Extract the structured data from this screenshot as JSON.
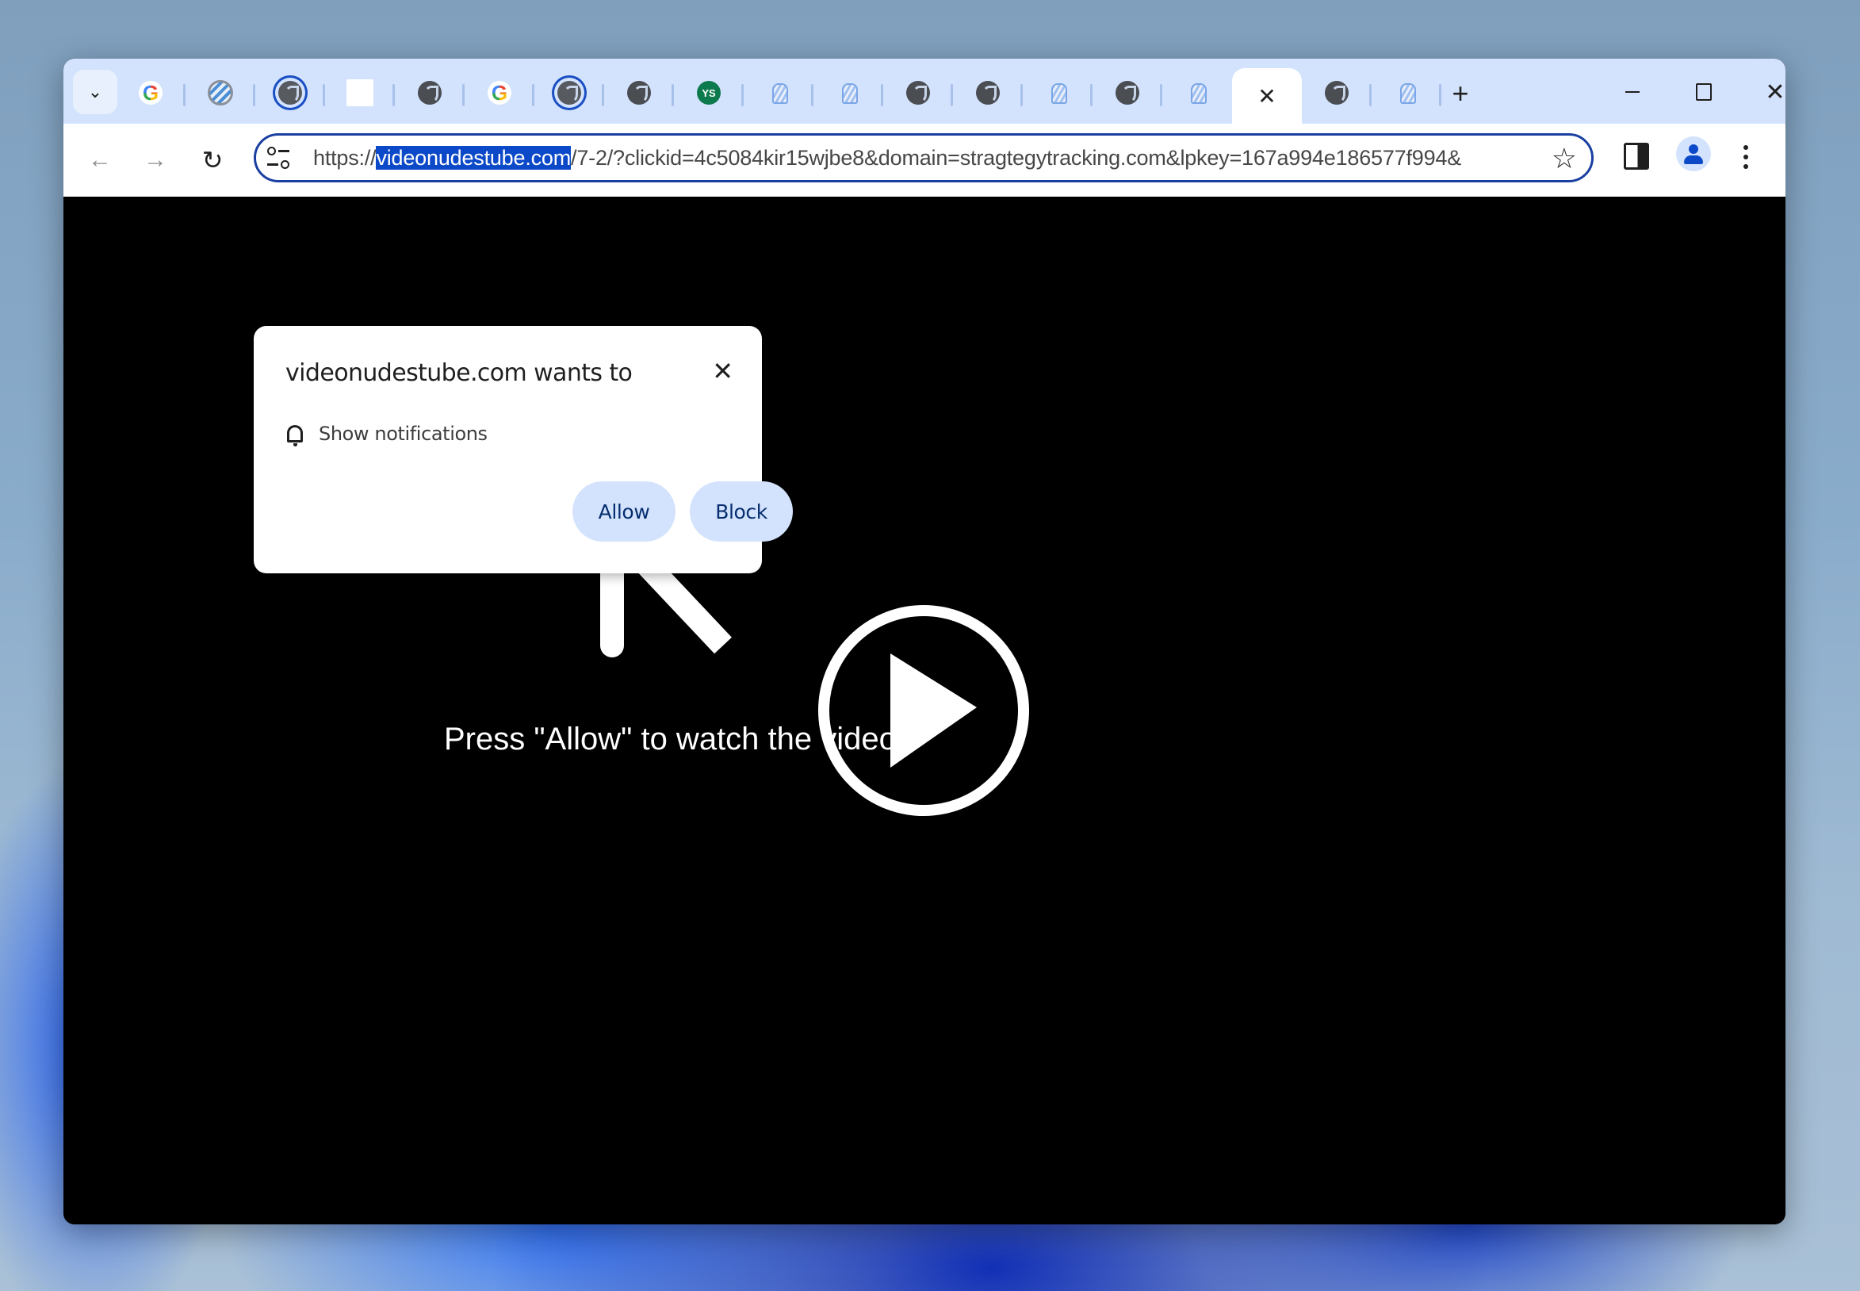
{
  "browser": {
    "tabs": [
      {
        "favicon": "google-icon",
        "active": false
      },
      {
        "favicon": "striped-circle-icon",
        "active": false
      },
      {
        "favicon": "loading-globe-icon",
        "active": false
      },
      {
        "favicon": "blank-page-icon",
        "active": false
      },
      {
        "favicon": "globe-icon",
        "active": false
      },
      {
        "favicon": "google-icon",
        "active": false
      },
      {
        "favicon": "loading-globe-icon",
        "active": false
      },
      {
        "favicon": "globe-icon",
        "active": false
      },
      {
        "favicon": "ys-icon",
        "active": false,
        "label": "YS"
      },
      {
        "favicon": "notification-bell-icon",
        "active": false
      },
      {
        "favicon": "notification-bell-icon",
        "active": false
      },
      {
        "favicon": "globe-icon",
        "active": false
      },
      {
        "favicon": "globe-icon",
        "active": false
      },
      {
        "favicon": "notification-bell-icon",
        "active": false
      },
      {
        "favicon": "globe-icon",
        "active": false
      },
      {
        "favicon": "notification-bell-icon",
        "active": false
      },
      {
        "favicon": "close-icon",
        "active": true
      },
      {
        "favicon": "globe-icon",
        "active": false
      },
      {
        "favicon": "notification-bell-icon",
        "active": false
      }
    ],
    "tab_search_glyph": "⌄",
    "active_tab_close_glyph": "✕",
    "new_tab_glyph": "+",
    "window_controls": {
      "minimize": "minimize",
      "maximize": "maximize",
      "close_glyph": "✕"
    },
    "nav": {
      "back_glyph": "←",
      "forward_glyph": "→",
      "reload_glyph": "↻"
    },
    "address_bar": {
      "scheme": "https://",
      "host_selected": "videonudestube.com",
      "path": "/7-2/?clickid=4c5084kir15wjbe8&domain=stragtegytracking.com&lpkey=167a994e186577f994&",
      "bookmark_glyph": "☆"
    }
  },
  "permission_prompt": {
    "title": "videonudestube.com wants to",
    "close_glyph": "✕",
    "permission": "Show notifications",
    "allow_label": "Allow",
    "block_label": "Block"
  },
  "page": {
    "instruction_text": "Press \"Allow\" to watch the video",
    "play_button": "play-icon"
  },
  "colors": {
    "tabstrip_bg": "#d3e3fd",
    "omnibox_border": "#1a3fa0",
    "selection_bg": "#0b49c8",
    "button_bg": "#d3e3fd",
    "button_text": "#062e6f",
    "page_bg": "#000000"
  }
}
